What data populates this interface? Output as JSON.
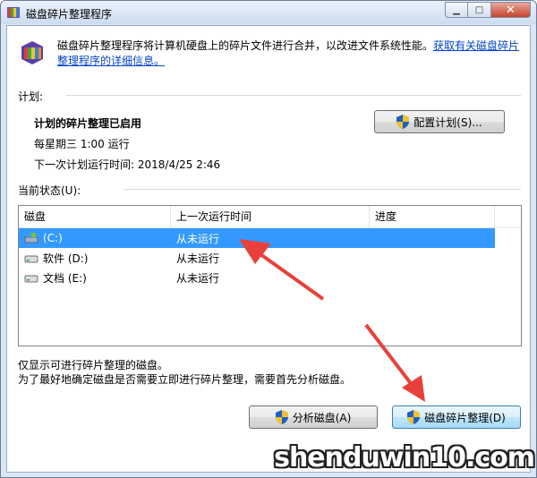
{
  "window": {
    "title": "磁盘碎片整理程序",
    "controls": {
      "minimize": "▁",
      "maximize": "□",
      "close": "✕"
    }
  },
  "intro": {
    "text": "磁盘碎片整理程序将计算机硬盘上的碎片文件进行合并，以改进文件系统性能。",
    "link": "获取有关磁盘碎片整理程序的详细信息。"
  },
  "schedule": {
    "section_label": "计划:",
    "status": "计划的碎片整理已启用",
    "when": "每星期三  1:00 运行",
    "next_run": "下一次计划运行时间: 2018/4/25 2:46",
    "configure_button": "配置计划(S)..."
  },
  "current_status": {
    "section_label": "当前状态(U):",
    "columns": [
      "磁盘",
      "上一次运行时间",
      "进度"
    ],
    "rows": [
      {
        "disk": "(C:)",
        "last_run": "从未运行",
        "progress": "",
        "icon": "system-drive-icon"
      },
      {
        "disk": "软件 (D:)",
        "last_run": "从未运行",
        "progress": "",
        "icon": "drive-icon"
      },
      {
        "disk": "文档 (E:)",
        "last_run": "从未运行",
        "progress": "",
        "icon": "drive-icon"
      }
    ]
  },
  "notes": {
    "line1": "仅显示可进行碎片整理的磁盘。",
    "line2": "为了最好地确定磁盘是否需要立即进行碎片整理，需要首先分析磁盘。"
  },
  "actions": {
    "analyze_button": "分析磁盘(A)",
    "defrag_button": "磁盘碎片整理(D)"
  },
  "watermark": "shenduwin10.com",
  "colors": {
    "selection": "#3399ff",
    "arrow": "#e8413b",
    "link": "#0645c8"
  }
}
